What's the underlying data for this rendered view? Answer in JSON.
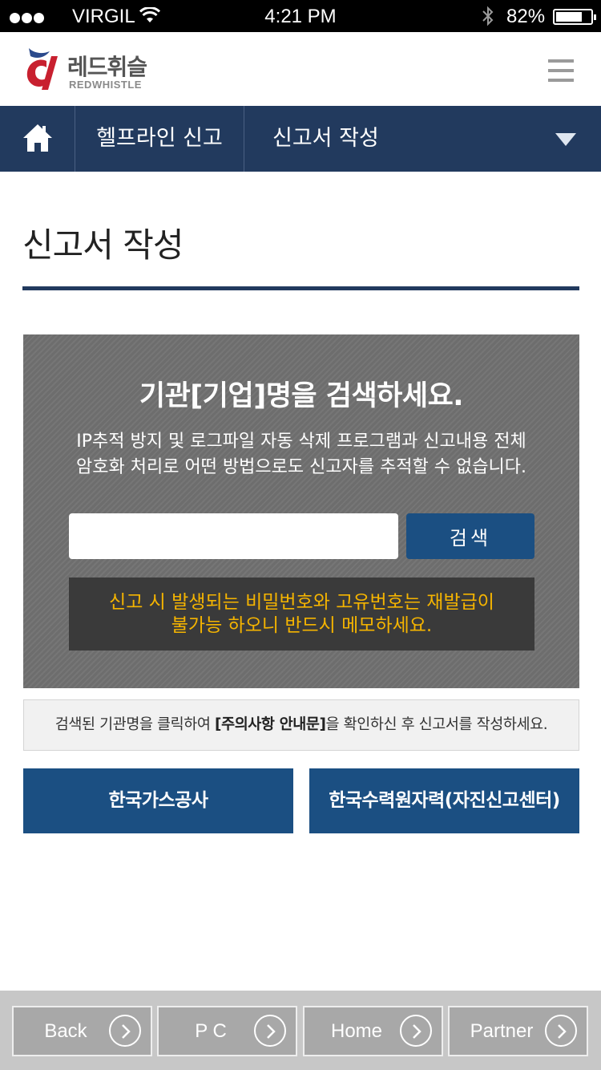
{
  "status_bar": {
    "carrier": "VIRGIL",
    "time": "4:21 PM",
    "battery_percent": "82%",
    "icons": [
      "signal-dots-icon",
      "wifi-icon",
      "bluetooth-icon",
      "battery-icon"
    ]
  },
  "header": {
    "logo_ko": "레드휘슬",
    "logo_en": "REDWHISTLE",
    "menu_icon": "hamburger-icon"
  },
  "nav": {
    "home_icon": "home-icon",
    "crumb1": "헬프라인 신고",
    "crumb2": "신고서 작성",
    "dropdown_icon": "triangle-down-icon"
  },
  "page": {
    "title": "신고서 작성"
  },
  "search": {
    "heading": "기관[기업]명을 검색하세요.",
    "desc_line1": "IP추적 방지 및 로그파일 자동 삭제 프로그램과 신고내용 전체",
    "desc_line2": "암호화 처리로 어떤 방법으로도 신고자를 추적할 수 없습니다.",
    "input_value": "",
    "button_label": "검색",
    "notice_line1": "신고 시 발생되는 비밀번호와 고유번호는 재발급이",
    "notice_line2": "불가능 하오니 반드시 메모하세요."
  },
  "instruction": {
    "before": "검색된 기관명을 클릭하여 ",
    "bold": "[주의사항 안내문]",
    "after": "을 확인하신 후 신고서를 작성하세요."
  },
  "orgs": [
    {
      "label": "한국가스공사"
    },
    {
      "label": "한국수력원자력(자진신고센터)"
    }
  ],
  "bottom_nav": [
    {
      "label": "Back"
    },
    {
      "label": "P C"
    },
    {
      "label": "Home"
    },
    {
      "label": "Partner"
    }
  ],
  "colors": {
    "navy": "#223a5e",
    "button_blue": "#1b4f82",
    "notice_yellow": "#f5b400",
    "panel_gray": "#6d6d6d"
  }
}
